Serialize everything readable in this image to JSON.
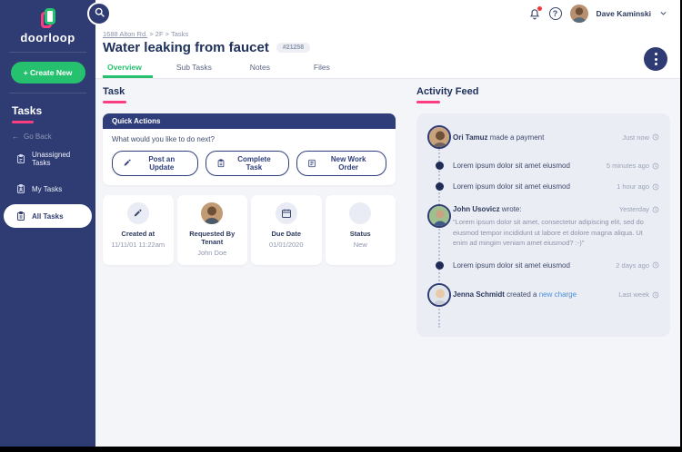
{
  "colors": {
    "navy": "#2f3c73",
    "green": "#26c16e",
    "pink": "#fc3e81",
    "content_bg": "#f4f5f9",
    "feed_bg": "#ebedf5",
    "link_blue": "#4a90d9",
    "alert_red": "#f0393c"
  },
  "brand": {
    "wordmark": "doorloop"
  },
  "sidebar": {
    "create_button_label": "+ Create New",
    "section_title": "Tasks",
    "back_label": "Go Back",
    "back_arrow": "←",
    "items": [
      {
        "label": "Unassigned Tasks",
        "active": false
      },
      {
        "label": "My Tasks",
        "active": false
      },
      {
        "label": "All Tasks",
        "active": true
      }
    ]
  },
  "topbar": {
    "user_name": "Dave Kaminski"
  },
  "breadcrumb": {
    "property": "1688 Alton Rd.",
    "separator": ">",
    "unit": "2F",
    "section": "Tasks"
  },
  "page": {
    "title": "Water leaking from faucet",
    "badge": "#21258",
    "tabs": [
      {
        "label": "Overview",
        "active": true
      },
      {
        "label": "Sub Tasks",
        "active": false
      },
      {
        "label": "Notes",
        "active": false
      },
      {
        "label": "Files",
        "active": false
      }
    ]
  },
  "task": {
    "section_title": "Task",
    "quick_actions": {
      "title": "Quick Actions",
      "prompt": "What would you like to do next?",
      "buttons": [
        {
          "label": "Post an Update",
          "icon": "pencil-icon"
        },
        {
          "label": "Complete Task",
          "icon": "clipboard-icon"
        },
        {
          "label": "New Work Order",
          "icon": "work-order-icon"
        }
      ]
    },
    "info_cards": [
      {
        "label": "Created at",
        "value": "11/11/01  11:22am",
        "icon": "pencil-icon"
      },
      {
        "label": "Requested By Tenant",
        "value": "John Doe",
        "icon": "tenant-avatar"
      },
      {
        "label": "Due Date",
        "value": "01/01/2020",
        "icon": "calendar-icon"
      },
      {
        "label": "Status",
        "value": "New",
        "icon": "status-circle"
      }
    ]
  },
  "activity_feed": {
    "section_title": "Activity Feed",
    "items": [
      {
        "type": "avatar",
        "actor": "Ori Tamuz",
        "action": " made a payment",
        "time": "Just now"
      },
      {
        "type": "dot",
        "text": "Lorem ipsum dolor sit amet eiusmod",
        "time": "5 minutes ago"
      },
      {
        "type": "dot",
        "text": "Lorem ipsum dolor sit amet eiusmod",
        "time": "1 hour ago"
      },
      {
        "type": "avatar",
        "actor": "John Usovicz",
        "action": " wrote:",
        "time": "Yesterday",
        "quote": "\"Lorem ipsum dolor sit amet, consectetur adipiscing elit, sed do eiusmod tempor incididunt ut labore et dolore magna aliqua. Ut enim ad mingim veniam amet eiusmod? :-)\""
      },
      {
        "type": "dot",
        "text": "Lorem ipsum dolor sit amet eiusmod",
        "time": "2 days ago"
      },
      {
        "type": "avatar",
        "actor": "Jenna Schmidt",
        "action": " created a ",
        "link": "new charge",
        "time": "Last week"
      }
    ]
  }
}
